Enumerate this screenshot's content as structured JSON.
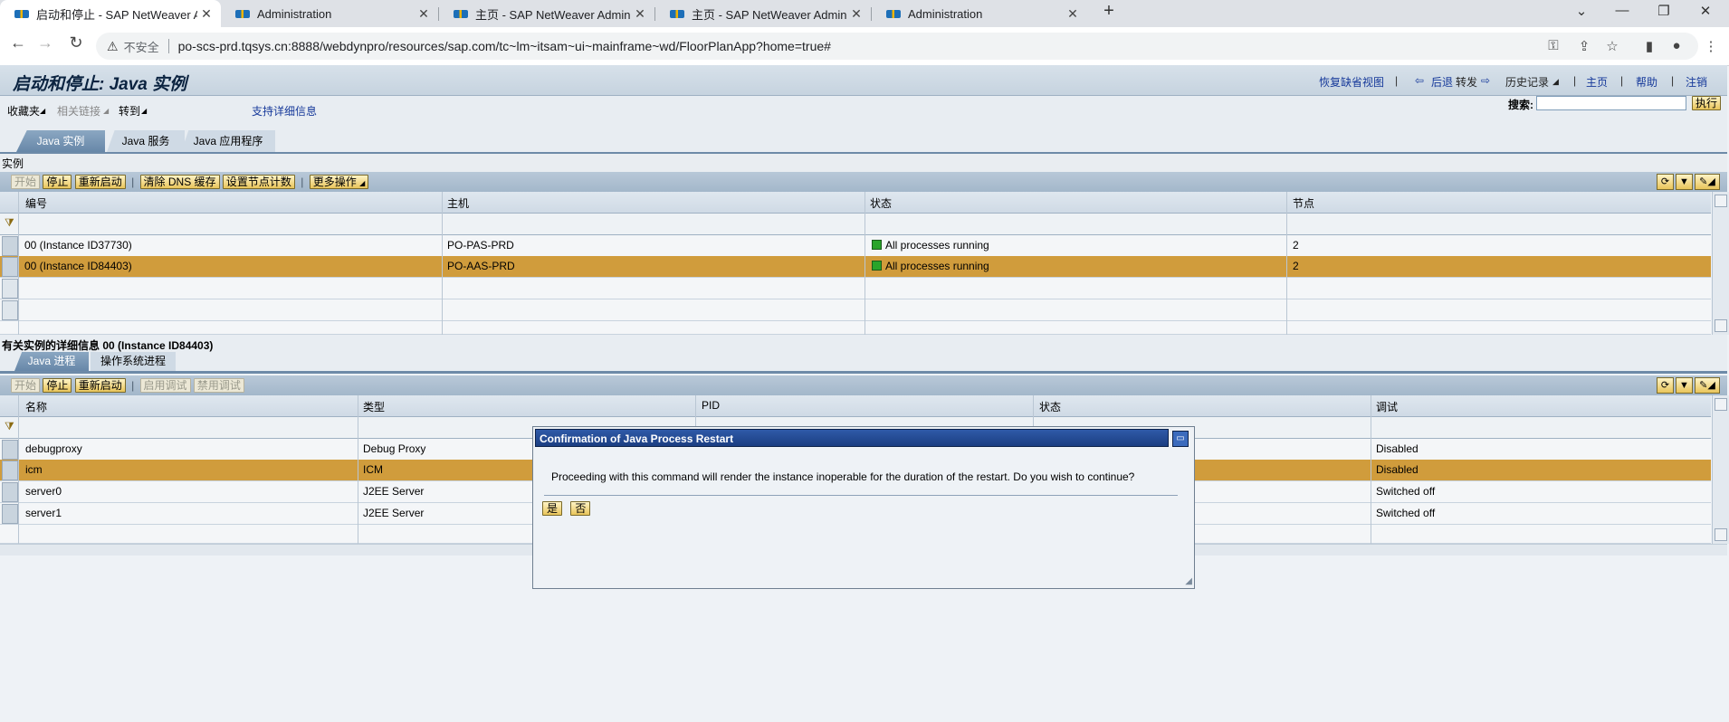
{
  "browser": {
    "tabs": [
      {
        "title": "启动和停止 - SAP NetWeaver A",
        "active": true
      },
      {
        "title": "Administration",
        "active": false
      },
      {
        "title": "主页 - SAP NetWeaver Admini",
        "active": false
      },
      {
        "title": "主页 - SAP NetWeaver Admini",
        "active": false
      },
      {
        "title": "Administration",
        "active": false
      }
    ],
    "new_tab": "+",
    "not_secure": "不安全",
    "url": "po-scs-prd.tqsys.cn:8888/webdynpro/resources/sap.com/tc~lm~itsam~ui~mainframe~wd/FloorPlanApp?home=true#"
  },
  "header": {
    "title": "启动和停止: Java 实例",
    "links": {
      "restore_default_view": "恢复缺省视图",
      "back": "后退",
      "forward": "转发",
      "history": "历史记录",
      "home": "主页",
      "help": "帮助",
      "logout": "注销"
    }
  },
  "menu": {
    "favorites": "收藏夹",
    "related_links": "相关链接",
    "goto": "转到",
    "support_details": "支持详细信息",
    "search_label": "搜索:",
    "execute": "执行"
  },
  "main_tabs": [
    "Java 实例",
    "Java 服务",
    "Java 应用程序"
  ],
  "instances": {
    "section_label": "实例",
    "toolbar": {
      "start": "开始",
      "stop": "停止",
      "restart": "重新启动",
      "clear_dns": "清除 DNS 缓存",
      "set_node_count": "设置节点计数",
      "more_actions": "更多操作"
    },
    "columns": [
      "编号",
      "主机",
      "状态",
      "节点"
    ],
    "rows": [
      {
        "id": "00 (Instance ID37730)",
        "host": "PO-PAS-PRD",
        "status": "All processes running",
        "nodes": "2"
      },
      {
        "id": "00 (Instance ID84403)",
        "host": "PO-AAS-PRD",
        "status": "All processes running",
        "nodes": "2"
      }
    ]
  },
  "details": {
    "section_label": "有关实例的详细信息 00 (Instance ID84403)",
    "tabs": [
      "Java 进程",
      "操作系统进程"
    ],
    "toolbar": {
      "start": "开始",
      "stop": "停止",
      "restart": "重新启动",
      "enable_debug": "启用调试",
      "disable_debug": "禁用调试"
    },
    "columns": [
      "名称",
      "类型",
      "PID",
      "状态",
      "调试"
    ],
    "rows": [
      {
        "name": "debugproxy",
        "type": "Debug Proxy",
        "debug": "Disabled"
      },
      {
        "name": "icm",
        "type": "ICM",
        "debug": "Disabled"
      },
      {
        "name": "server0",
        "type": "J2EE Server",
        "debug": "Switched off"
      },
      {
        "name": "server1",
        "type": "J2EE Server",
        "debug": "Switched off"
      }
    ]
  },
  "dialog": {
    "title": "Confirmation of Java Process Restart",
    "message": "Proceeding with this command will render the instance inoperable for the duration of the restart. Do you wish to continue?",
    "yes": "是",
    "no": "否"
  },
  "colors": {
    "selected_row": "#d09c3c",
    "title_bar": "#1b3e82",
    "status_ok": "#2aa42a"
  }
}
